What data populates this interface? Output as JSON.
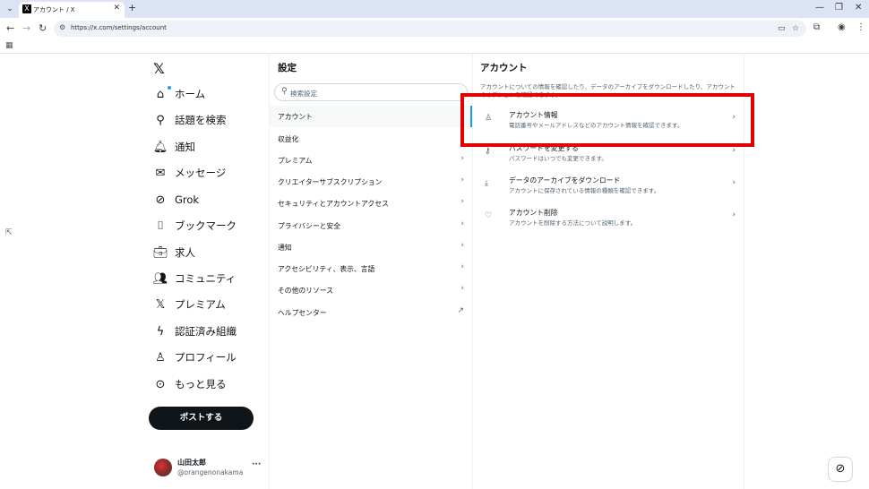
{
  "browser": {
    "tab_title": "アカウント / X",
    "url": "https://x.com/settings/account"
  },
  "nav": {
    "items": [
      {
        "label": "ホーム",
        "icon": "home-icon"
      },
      {
        "label": "話題を検索",
        "icon": "search-icon"
      },
      {
        "label": "通知",
        "icon": "bell-icon"
      },
      {
        "label": "メッセージ",
        "icon": "mail-icon"
      },
      {
        "label": "Grok",
        "icon": "grok-icon"
      },
      {
        "label": "ブックマーク",
        "icon": "bookmark-icon"
      },
      {
        "label": "求人",
        "icon": "briefcase-icon"
      },
      {
        "label": "コミュニティ",
        "icon": "people-icon"
      },
      {
        "label": "プレミアム",
        "icon": "x-logo-icon"
      },
      {
        "label": "認証済み組織",
        "icon": "lightning-icon"
      },
      {
        "label": "プロフィール",
        "icon": "person-icon"
      },
      {
        "label": "もっと見る",
        "icon": "more-circle-icon"
      }
    ],
    "post_button": "ポストする",
    "profile_name": "山田太郎",
    "profile_handle": "@orangenonakama"
  },
  "settings": {
    "title": "設定",
    "search_placeholder": "検索設定",
    "items": [
      {
        "label": "アカウント",
        "arrow": ""
      },
      {
        "label": "収益化",
        "arrow": ""
      },
      {
        "label": "プレミアム",
        "arrow": "›"
      },
      {
        "label": "クリエイターサブスクリプション",
        "arrow": "›"
      },
      {
        "label": "セキュリティとアカウントアクセス",
        "arrow": "›"
      },
      {
        "label": "プライバシーと安全",
        "arrow": "›"
      },
      {
        "label": "通知",
        "arrow": "›"
      },
      {
        "label": "アクセシビリティ、表示、言語",
        "arrow": "›"
      },
      {
        "label": "その他のリソース",
        "arrow": "›"
      },
      {
        "label": "ヘルプセンター",
        "arrow": "↗"
      }
    ]
  },
  "account": {
    "title": "アカウント",
    "description": "アカウントについての情報を確認したり、データのアーカイブをダウンロードしたり、アカウントのオプションを確認できます。",
    "items": [
      {
        "label": "アカウント情報",
        "sub": "電話番号やメールアドレスなどのアカウント情報を確認できます。",
        "icon": "person-icon"
      },
      {
        "label": "パスワードを変更する",
        "sub": "パスワードはいつでも変更できます。",
        "icon": "key-icon"
      },
      {
        "label": "データのアーカイブをダウンロード",
        "sub": "アカウントに保存されている情報の種類を確認できます。",
        "icon": "download-icon"
      },
      {
        "label": "アカウント削除",
        "sub": "アカウントを削除する方法について説明します。",
        "icon": "broken-heart-icon"
      }
    ]
  },
  "colors": {
    "accent": "#1d9bf0",
    "highlight": "#e00000"
  }
}
